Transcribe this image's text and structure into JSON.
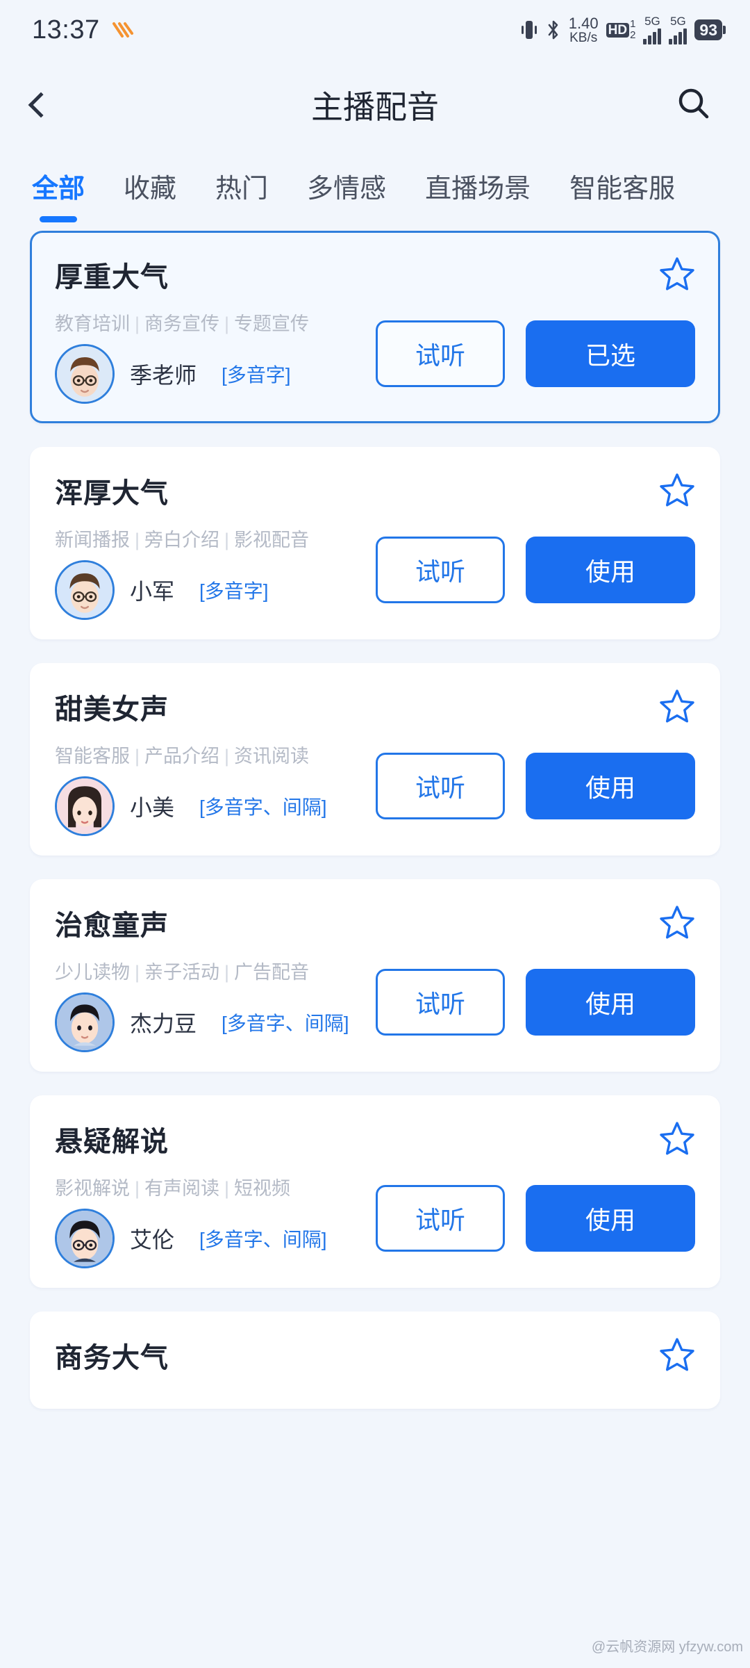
{
  "statusbar": {
    "time": "13:37",
    "logo_icon": "heart-logo-icon",
    "vibrate_icon": "vibrate-icon",
    "bluetooth_icon": "bluetooth-icon",
    "net_speed_value": "1.40",
    "net_speed_unit": "KB/s",
    "hd_label": "HD",
    "hd_sup": "1",
    "hd_sub": "2",
    "signal1_label": "5G",
    "signal2_label": "5G",
    "battery": "93"
  },
  "header": {
    "back_icon": "back-chevron-icon",
    "title": "主播配音",
    "search_icon": "search-icon"
  },
  "tabs": [
    {
      "label": "全部",
      "active": true
    },
    {
      "label": "收藏",
      "active": false
    },
    {
      "label": "热门",
      "active": false
    },
    {
      "label": "多情感",
      "active": false
    },
    {
      "label": "直播场景",
      "active": false
    },
    {
      "label": "智能客服",
      "active": false
    }
  ],
  "colors": {
    "accent": "#1677ff",
    "primary_button": "#1a6ef0",
    "outline_button": "#2276e8",
    "page_bg": "#f2f6fc",
    "card_bg": "#ffffff",
    "selected_card_bg": "#f4f9ff",
    "selected_card_border": "#2f7fdc",
    "tag_text": "#b4bac6",
    "title_text": "#1f2532"
  },
  "cards": [
    {
      "title": "厚重大气",
      "tags": [
        "教育培训",
        "商务宣传",
        "专题宣传"
      ],
      "speaker": "季老师",
      "speaker_meta": "[多音字]",
      "avatar": "male-glasses-brown-hair-avatar",
      "star_icon": "star-outline-icon",
      "preview_label": "试听",
      "action_label": "已选",
      "selected": true
    },
    {
      "title": "浑厚大气",
      "tags": [
        "新闻播报",
        "旁白介绍",
        "影视配音"
      ],
      "speaker": "小军",
      "speaker_meta": "[多音字]",
      "avatar": "male-glasses-short-hair-avatar",
      "star_icon": "star-outline-icon",
      "preview_label": "试听",
      "action_label": "使用",
      "selected": false
    },
    {
      "title": "甜美女声",
      "tags": [
        "智能客服",
        "产品介绍",
        "资讯阅读"
      ],
      "speaker": "小美",
      "speaker_meta": "[多音字、间隔]",
      "avatar": "female-long-dark-hair-avatar",
      "star_icon": "star-outline-icon",
      "preview_label": "试听",
      "action_label": "使用",
      "selected": false
    },
    {
      "title": "治愈童声",
      "tags": [
        "少儿读物",
        "亲子活动",
        "广告配音"
      ],
      "speaker": "杰力豆",
      "speaker_meta": "[多音字、间隔]",
      "avatar": "boy-black-hair-avatar",
      "star_icon": "star-outline-icon",
      "preview_label": "试听",
      "action_label": "使用",
      "selected": false
    },
    {
      "title": "悬疑解说",
      "tags": [
        "影视解说",
        "有声阅读",
        "短视频"
      ],
      "speaker": "艾伦",
      "speaker_meta": "[多音字、间隔]",
      "avatar": "male-glasses-black-hair-avatar",
      "star_icon": "star-outline-icon",
      "preview_label": "试听",
      "action_label": "使用",
      "selected": false
    },
    {
      "title": "商务大气",
      "tags": [],
      "speaker": "",
      "speaker_meta": "",
      "avatar": "",
      "star_icon": "star-outline-icon",
      "preview_label": "",
      "action_label": "",
      "selected": false,
      "partial": true
    }
  ],
  "watermark": "@云帆资源网 yfzyw.com"
}
